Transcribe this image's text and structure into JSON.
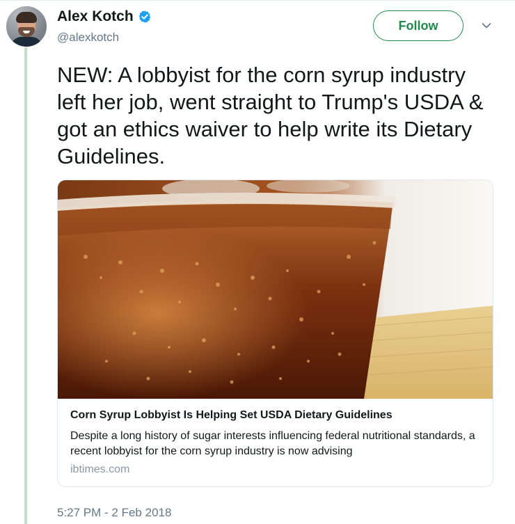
{
  "author": {
    "display_name": "Alex Kotch",
    "handle": "@alexkotch",
    "verified": true
  },
  "follow_label": "Follow",
  "tweet_text": "NEW: A lobbyist for the corn syrup industry left her job, went straight to Trump's USDA & got an ethics waiver to help write its Dietary Guidelines.",
  "card": {
    "title": "Corn Syrup Lobbyist Is Helping Set USDA Dietary Guidelines",
    "description": "Despite a long history of sugar interests influencing federal nutritional standards, a recent lobbyist for the corn syrup industry is now advising",
    "domain": "ibtimes.com",
    "image_icon": "cola-glass-photo"
  },
  "timestamp": "5:27 PM - 2 Feb 2018",
  "colors": {
    "follow_green": "#1f8a4c",
    "thread_line": "#c4dfc9",
    "verified_blue": "#1da1f2",
    "muted_text": "#657786"
  },
  "icons": [
    "verified-badge-icon",
    "chevron-down-icon"
  ]
}
